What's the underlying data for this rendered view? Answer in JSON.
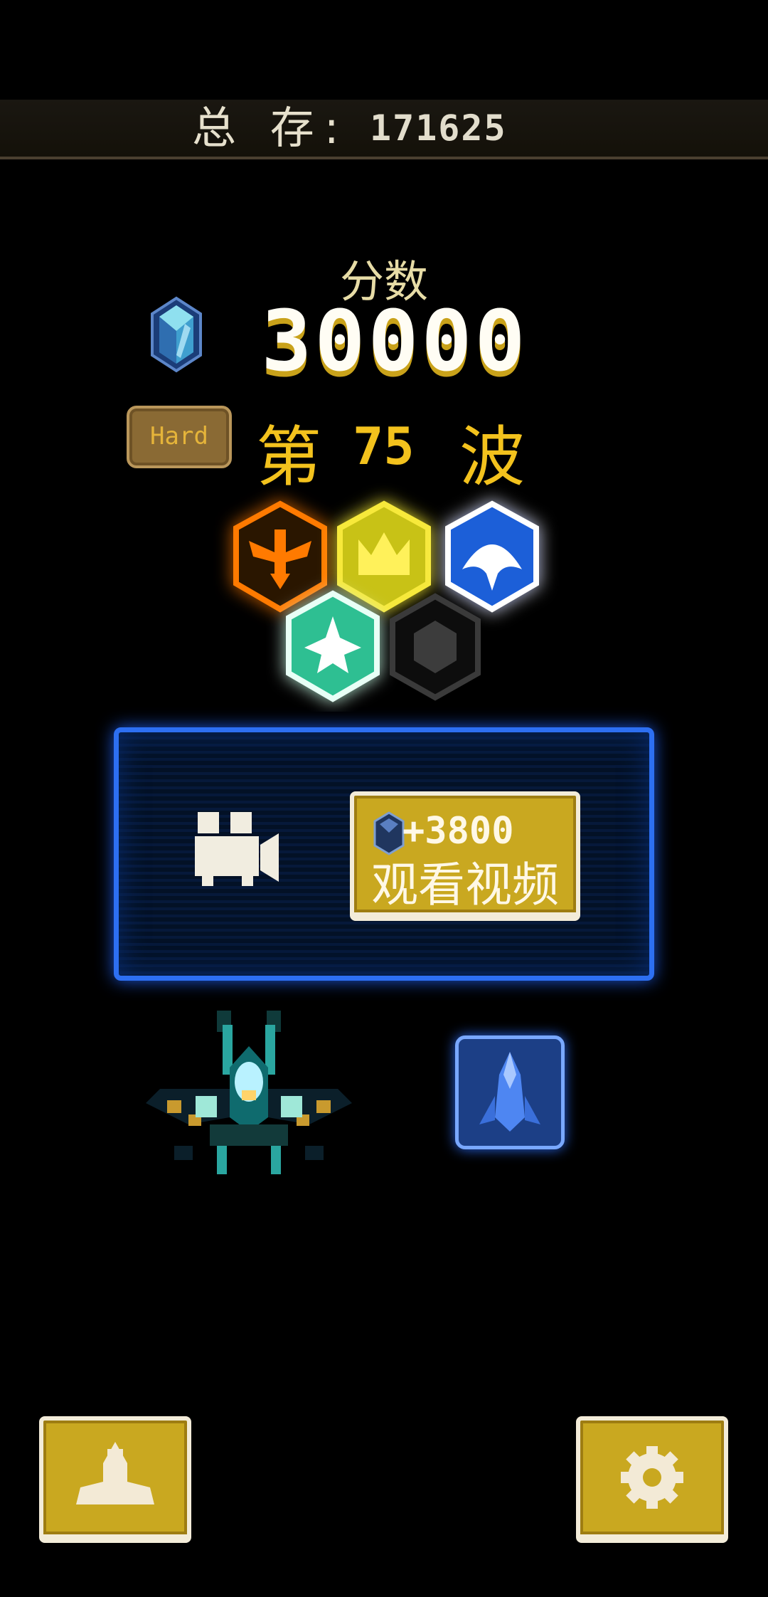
{
  "header": {
    "total_label": "总 存:",
    "total_value": "171625"
  },
  "score": {
    "label": "分数",
    "value": "30000"
  },
  "difficulty": {
    "label": "Hard"
  },
  "wave": {
    "prefix": "第",
    "number": "75",
    "suffix": "波"
  },
  "medals": [
    {
      "icon": "phoenix-icon",
      "color": "#ff7a00",
      "unlocked": true
    },
    {
      "icon": "crown-icon",
      "color": "#f2e21a",
      "unlocked": true
    },
    {
      "icon": "manta-icon",
      "color": "#1f5fd8",
      "unlocked": true
    },
    {
      "icon": "spaceship-icon",
      "color": "#2dbf92",
      "unlocked": true
    },
    {
      "icon": "locked-hex-icon",
      "color": "#333333",
      "unlocked": false
    }
  ],
  "reward": {
    "bonus": "+3800",
    "button_label": "观看视频",
    "camera_icon": "video-camera-icon"
  },
  "buttons": {
    "hangar_icon": "ship-icon",
    "settings_icon": "gear-icon"
  },
  "colors": {
    "gold": "#f3c21d",
    "panel_border": "#2d6ff2",
    "button_gold": "#c9a820"
  }
}
